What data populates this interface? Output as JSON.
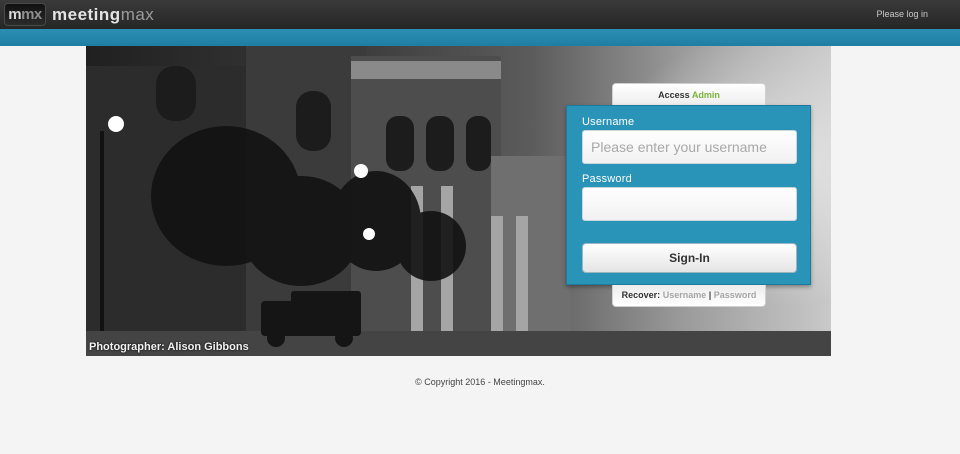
{
  "header": {
    "logo_badge_m": "m",
    "logo_badge_mx": "mx",
    "logo_word_meeting": "meeting",
    "logo_word_max": "max",
    "status": "Please log in"
  },
  "hero": {
    "photo_credit": "Photographer: Alison Gibbons"
  },
  "login": {
    "access_prefix": "Access",
    "access_role": "Admin",
    "username_label": "Username",
    "username_placeholder": "Please enter your username",
    "username_value": "",
    "password_label": "Password",
    "password_value": "",
    "signin_label": "Sign-In"
  },
  "recover": {
    "label": "Recover:",
    "username_link": "Username",
    "separator": "|",
    "password_link": "Password"
  },
  "footer": {
    "copyright": "© Copyright 2016 - Meetingmax."
  },
  "colors": {
    "accent_blue": "#2a94b8",
    "admin_green": "#7ab23a",
    "topbar": "#2d2d2d"
  }
}
